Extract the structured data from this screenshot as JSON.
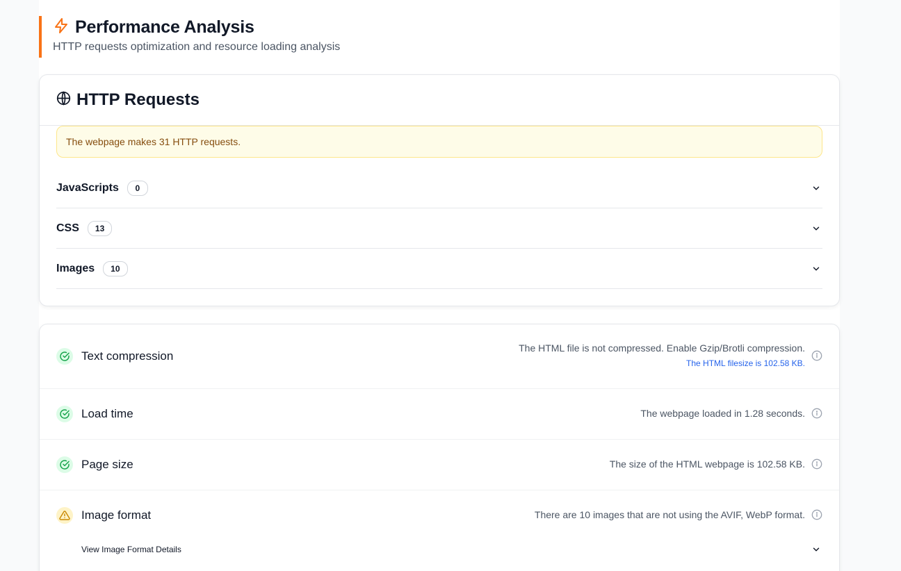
{
  "header": {
    "title": "Performance Analysis",
    "subtitle": "HTTP requests optimization and resource loading analysis",
    "icon": "lightning-icon",
    "accent": "#f97316"
  },
  "http": {
    "title": "HTTP Requests",
    "icon": "globe-icon",
    "alert": "The webpage makes 31 HTTP requests.",
    "groups": [
      {
        "label": "JavaScripts",
        "count": "0"
      },
      {
        "label": "CSS",
        "count": "13"
      },
      {
        "label": "Images",
        "count": "10"
      }
    ]
  },
  "metrics": {
    "text_compression": {
      "label": "Text compression",
      "status": "ok",
      "message": "The HTML file is not compressed. Enable Gzip/Brotli compression.",
      "sub": "The HTML filesize is 102.58 KB."
    },
    "load_time": {
      "label": "Load time",
      "status": "ok",
      "message": "The webpage loaded in 1.28 seconds."
    },
    "page_size": {
      "label": "Page size",
      "status": "ok",
      "message": "The size of the HTML webpage is 102.58 KB."
    },
    "image_format": {
      "label": "Image format",
      "status": "warning",
      "message": "There are 10 images that are not using the AVIF, WebP format.",
      "details_label": "View Image Format Details"
    }
  },
  "colors": {
    "ok": "#16a34a",
    "warning": "#ca8a04",
    "link": "#2563eb"
  }
}
